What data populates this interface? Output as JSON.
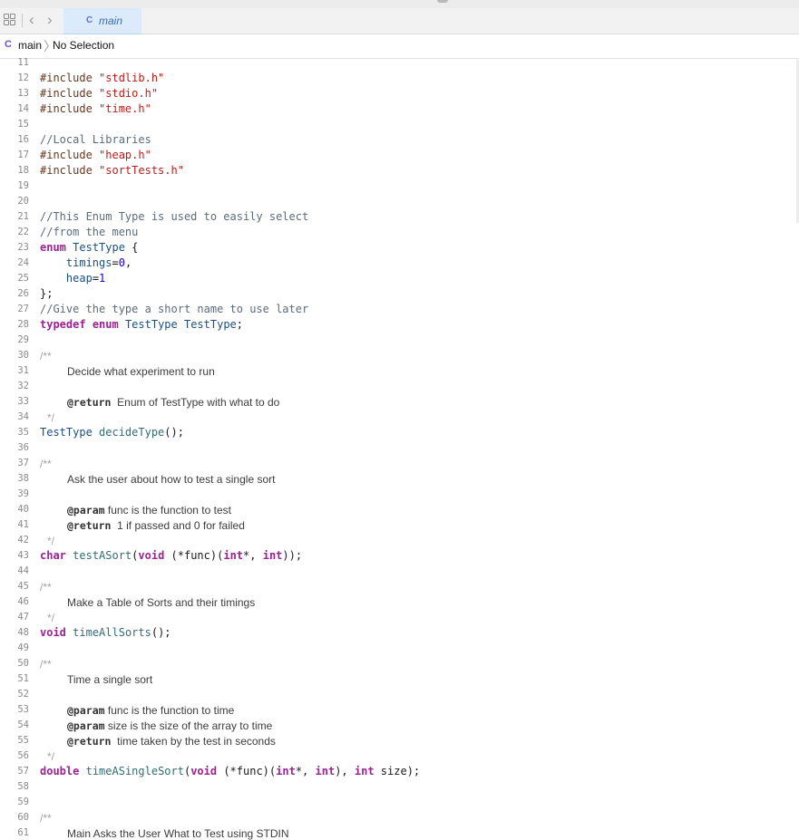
{
  "tab": {
    "badge": "C",
    "name": "main"
  },
  "jumpbar": {
    "file_badge": "C",
    "file": "main",
    "separator": "〉",
    "selection": "No Selection"
  },
  "lines": [
    {
      "n": "11",
      "html": ""
    },
    {
      "n": "12",
      "html": "<span class=\"pp\">#include</span> <span class=\"str\">\"stdlib.h\"</span>"
    },
    {
      "n": "13",
      "html": "<span class=\"pp\">#include</span> <span class=\"str\">\"stdio.h\"</span>"
    },
    {
      "n": "14",
      "html": "<span class=\"pp\">#include</span> <span class=\"str\">\"time.h\"</span>"
    },
    {
      "n": "15",
      "html": ""
    },
    {
      "n": "16",
      "html": "<span class=\"cm\">//Local Libraries</span>"
    },
    {
      "n": "17",
      "html": "<span class=\"pp\">#include</span> <span class=\"str\">\"heap.h\"</span>"
    },
    {
      "n": "18",
      "html": "<span class=\"pp\">#include</span> <span class=\"str\">\"sortTests.h\"</span>"
    },
    {
      "n": "19",
      "html": ""
    },
    {
      "n": "20",
      "html": ""
    },
    {
      "n": "21",
      "html": "<span class=\"cm\">//This Enum Type is used to easily select</span>"
    },
    {
      "n": "22",
      "html": "<span class=\"cm\">//from the menu</span>"
    },
    {
      "n": "23",
      "html": "<span class=\"kw\">enum</span> <span class=\"ty\">TestType</span> {"
    },
    {
      "n": "24",
      "html": "    <span class=\"ty\">timings</span>=<span class=\"num\">0</span>,"
    },
    {
      "n": "25",
      "html": "    <span class=\"ty\">heap</span>=<span class=\"num\">1</span>"
    },
    {
      "n": "26",
      "html": "};"
    },
    {
      "n": "27",
      "html": "<span class=\"cm\">//Give the type a short name to use later</span>"
    },
    {
      "n": "28",
      "html": "<span class=\"kw\">typedef</span> <span class=\"kw\">enum</span> <span class=\"ty\">TestType</span> <span class=\"ty\">TestType</span>;"
    },
    {
      "n": "29",
      "html": ""
    },
    {
      "n": "30",
      "html": "<span class=\"dcm\">/**</span>",
      "doc": true
    },
    {
      "n": "31",
      "html": "Decide what experiment to run",
      "doc": true,
      "indent": true
    },
    {
      "n": "32",
      "html": "",
      "doc": true
    },
    {
      "n": "33",
      "html": "<b>@return</b>  Enum of TestType with what to do",
      "doc": true,
      "indent": true
    },
    {
      "n": "34",
      "html": "<span class=\"dcm\">*/</span>",
      "doc": true,
      "star": true
    },
    {
      "n": "35",
      "html": "<span class=\"ty\">TestType</span> <span class=\"fn\">decideType</span>();"
    },
    {
      "n": "36",
      "html": ""
    },
    {
      "n": "37",
      "html": "<span class=\"dcm\">/**</span>",
      "doc": true
    },
    {
      "n": "38",
      "html": "Ask the user about how to test a single sort",
      "doc": true,
      "indent": true
    },
    {
      "n": "39",
      "html": "",
      "doc": true
    },
    {
      "n": "40",
      "html": "<b>@param</b> func is the function to test",
      "doc": true,
      "indent": true
    },
    {
      "n": "41",
      "html": "<b>@return</b>  1 if passed and 0 for failed",
      "doc": true,
      "indent": true
    },
    {
      "n": "42",
      "html": "<span class=\"dcm\">*/</span>",
      "doc": true,
      "star": true
    },
    {
      "n": "43",
      "html": "<span class=\"kw\">char</span> <span class=\"fn\">testASort</span>(<span class=\"kw\">void</span> (*func)(<span class=\"kw\">int</span>*, <span class=\"kw\">int</span>));"
    },
    {
      "n": "44",
      "html": ""
    },
    {
      "n": "45",
      "html": "<span class=\"dcm\">/**</span>",
      "doc": true
    },
    {
      "n": "46",
      "html": "Make a Table of Sorts and their timings",
      "doc": true,
      "indent": true
    },
    {
      "n": "47",
      "html": "<span class=\"dcm\">*/</span>",
      "doc": true,
      "star": true
    },
    {
      "n": "48",
      "html": "<span class=\"kw\">void</span> <span class=\"fn\">timeAllSorts</span>();"
    },
    {
      "n": "49",
      "html": ""
    },
    {
      "n": "50",
      "html": "<span class=\"dcm\">/**</span>",
      "doc": true
    },
    {
      "n": "51",
      "html": "Time a single sort",
      "doc": true,
      "indent": true
    },
    {
      "n": "52",
      "html": "",
      "doc": true
    },
    {
      "n": "53",
      "html": "<b>@param</b> func is the function to time",
      "doc": true,
      "indent": true
    },
    {
      "n": "54",
      "html": "<b>@param</b> size is the size of the array to time",
      "doc": true,
      "indent": true
    },
    {
      "n": "55",
      "html": "<b>@return</b>  time taken by the test in seconds",
      "doc": true,
      "indent": true
    },
    {
      "n": "56",
      "html": "<span class=\"dcm\">*/</span>",
      "doc": true,
      "star": true
    },
    {
      "n": "57",
      "html": "<span class=\"kw\">double</span> <span class=\"fn\">timeASingleSort</span>(<span class=\"kw\">void</span> (*func)(<span class=\"kw\">int</span>*, <span class=\"kw\">int</span>), <span class=\"kw\">int</span> size);"
    },
    {
      "n": "58",
      "html": ""
    },
    {
      "n": "59",
      "html": ""
    },
    {
      "n": "60",
      "html": "<span class=\"dcm\">/**</span>",
      "doc": true
    },
    {
      "n": "61",
      "html": "Main Asks the User What to Test using STDIN",
      "doc": true,
      "indent": true
    }
  ]
}
